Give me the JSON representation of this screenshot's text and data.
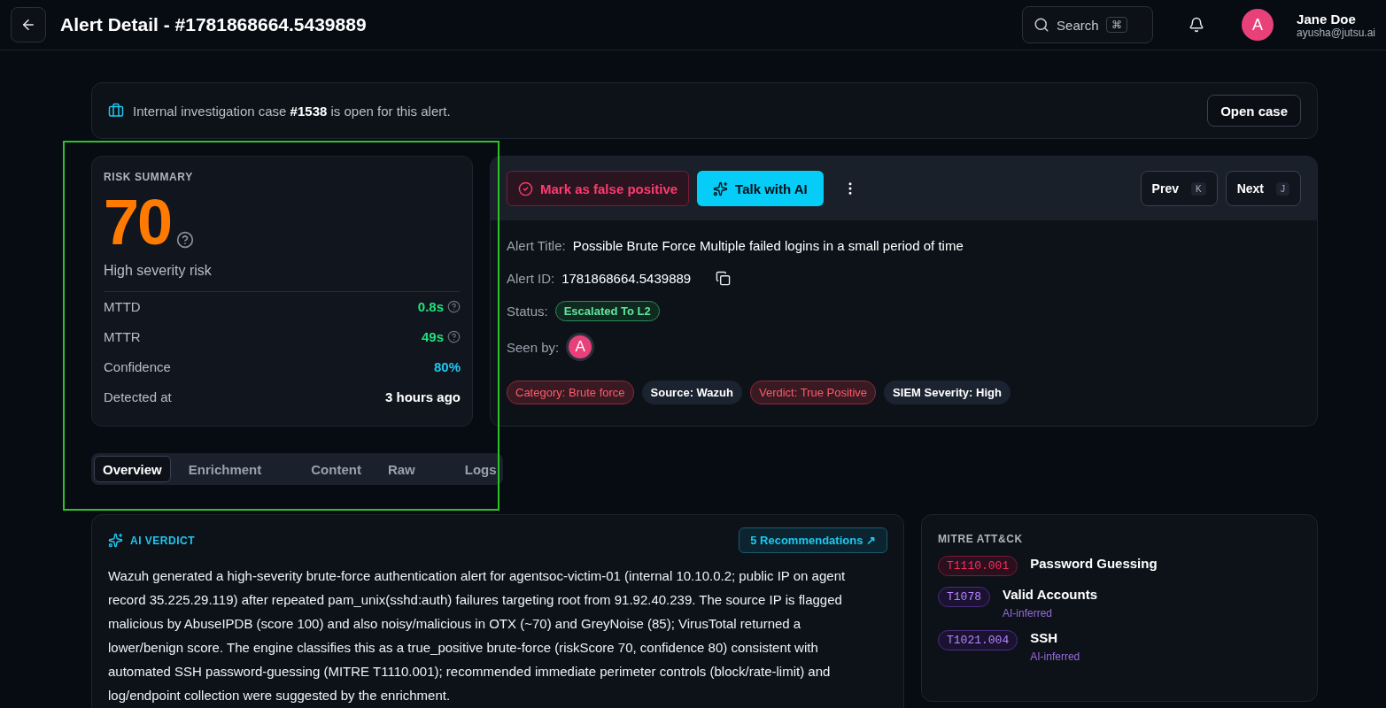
{
  "header": {
    "title": "Alert Detail - #1781868664.5439889",
    "search": {
      "label": "Search",
      "shortcut": "⌘"
    },
    "user": {
      "initial": "A",
      "name": "Jane Doe",
      "email": "ayusha@jutsu.ai"
    }
  },
  "banner": {
    "text": "Internal investigation case **#1538** is open for this alert.",
    "button": "Open case"
  },
  "risk": {
    "heading": "RISK SUMMARY",
    "score": "70",
    "severity": "High severity risk",
    "metrics": [
      {
        "label": "MTTD",
        "value": "0.8s",
        "color": "#22e27a",
        "help": true
      },
      {
        "label": "MTTR",
        "value": "49s",
        "color": "#22e27a",
        "help": true
      },
      {
        "label": "Confidence",
        "value": "80%",
        "color": "#1ec8f0",
        "help": false
      },
      {
        "label": "Detected at",
        "value": "3 hours ago",
        "color": "#ffffff",
        "help": false
      }
    ]
  },
  "actions": {
    "false_positive": "Mark as false positive",
    "talk": "Talk with AI",
    "prev": {
      "label": "Prev",
      "key": "K"
    },
    "next": {
      "label": "Next",
      "key": "J"
    }
  },
  "alert": {
    "title_label": "Alert Title:",
    "title": "Possible Brute Force Multiple failed logins in a small period of time",
    "id_label": "Alert ID:",
    "id": "1781868664.5439889",
    "status_label": "Status:",
    "status": "Escalated To L2",
    "seen_label": "Seen by:",
    "seen_initial": "A",
    "tags": [
      {
        "text": "Category: Brute force",
        "kind": "danger"
      },
      {
        "text": "Source: Wazuh",
        "kind": "neutral"
      },
      {
        "text": "Verdict: True Positive",
        "kind": "danger"
      },
      {
        "text": "SIEM Severity: High",
        "kind": "neutral"
      }
    ]
  },
  "tab_groups": [
    {
      "tabs": [
        {
          "label": "Overview",
          "selected": true
        },
        {
          "label": "Enrichment",
          "selected": false
        }
      ]
    },
    {
      "tabs": [
        {
          "label": "Content",
          "selected": false
        },
        {
          "label": "Raw",
          "selected": false
        }
      ]
    },
    {
      "tabs": [
        {
          "label": "Logs",
          "selected": false
        }
      ]
    }
  ],
  "verdict": {
    "heading": "AI VERDICT",
    "link": "5 Recommendations ↗",
    "text": "Wazuh generated a high-severity brute-force authentication alert for agentsoc-victim-01 (internal 10.10.0.2; public IP on agent record 35.225.29.119) after repeated pam_unix(sshd:auth) failures targeting root from 91.92.40.239. The source IP is flagged malicious by AbuseIPDB (score 100) and also noisy/malicious in OTX (~70) and GreyNoise (85); VirusTotal returned a lower/benign score. The engine classifies this as a true_positive brute-force (riskScore 70, confidence 80) consistent with automated SSH password-guessing (MITRE T1110.001); recommended immediate perimeter controls (block/rate-limit) and log/endpoint collection were suggested by the enrichment."
  },
  "mitre": {
    "heading": "MITRE ATT&CK",
    "techniques": [
      {
        "id": "T1110.001",
        "name": "Password Guessing",
        "kind": "observed"
      },
      {
        "id": "T1078",
        "name": "Valid Accounts",
        "kind": "inferred",
        "note": "AI-inferred"
      },
      {
        "id": "T1021.004",
        "name": "SSH",
        "kind": "inferred",
        "note": "AI-inferred"
      }
    ]
  }
}
